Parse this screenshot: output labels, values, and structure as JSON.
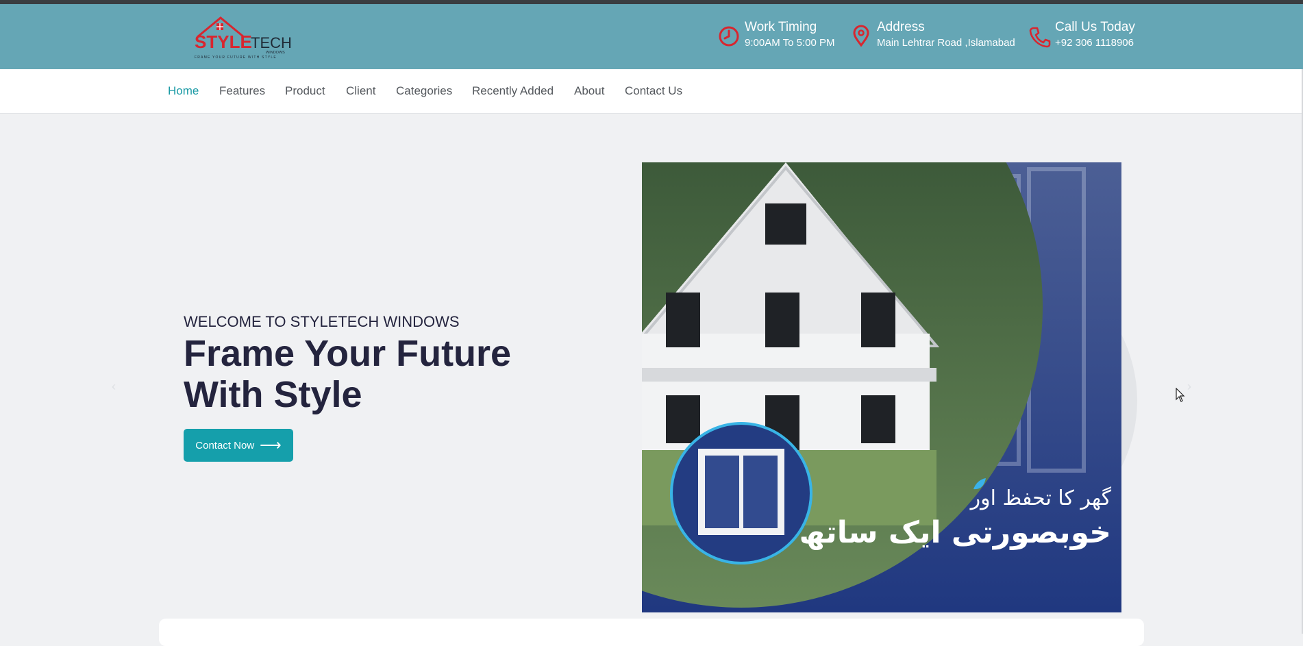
{
  "brand": {
    "name_red": "STYLE",
    "name_dark": "TECH",
    "sub": "WINDOWS",
    "tagline": "FRAME YOUR FUTURE WITH STYLE"
  },
  "topbar": {
    "timing": {
      "title": "Work Timing",
      "value": "9:00AM To 5:00 PM",
      "icon": "clock-icon"
    },
    "address": {
      "title": "Address",
      "value": "Main Lehtrar Road ,Islamabad",
      "icon": "map-pin-icon"
    },
    "phone": {
      "title": "Call Us Today",
      "value": "+92 306 1118906",
      "icon": "phone-icon"
    }
  },
  "nav": {
    "items": [
      {
        "label": "Home",
        "active": true
      },
      {
        "label": "Features"
      },
      {
        "label": "Product"
      },
      {
        "label": "Client"
      },
      {
        "label": "Categories"
      },
      {
        "label": "Recently Added"
      },
      {
        "label": "About"
      },
      {
        "label": "Contact Us"
      }
    ]
  },
  "hero": {
    "subtitle": "WELCOME TO STYLETECH WINDOWS",
    "title": "Frame Your Future With Style",
    "cta_label": "Contact Now",
    "cta_arrow": "⟶",
    "prev_icon": "‹",
    "next_icon": "›",
    "image_text_line1": "گھر کا تحفظ اور",
    "image_text_line2": "خوبصورتی ایک ساتھ"
  },
  "colors": {
    "topbar": "#65a6b5",
    "accent": "#159fab",
    "nav_active": "#1a9aa5",
    "heading": "#24243e",
    "icon_red": "#d8262f",
    "brand_red": "#d8262f"
  }
}
